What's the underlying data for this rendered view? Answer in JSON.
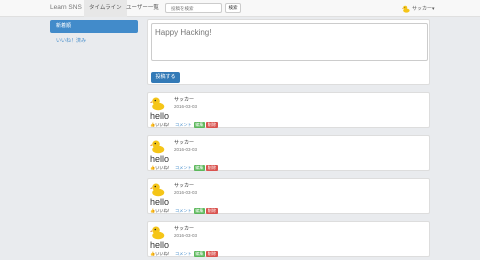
{
  "navbar": {
    "brand": "Learn SNS",
    "tabs": [
      {
        "label": "タイムライン"
      },
      {
        "label": "ユーザー一覧"
      }
    ],
    "search": {
      "placeholder": "投稿を検索",
      "button": "検索"
    },
    "user": {
      "name": "サッカー▾",
      "icon": "duck-icon"
    }
  },
  "sidebar": {
    "items": [
      {
        "label": "新着順"
      },
      {
        "label": "いいね！済み"
      }
    ]
  },
  "composer": {
    "placeholder": "Happy Hacking!",
    "submit": "投稿する"
  },
  "posts": [
    {
      "author": "サッカー",
      "date": "2016-03-03",
      "body": "hello",
      "like": "👍いいね！",
      "comment": "コメント",
      "edit": "編集",
      "delete": "削除"
    },
    {
      "author": "サッカー",
      "date": "2016-03-03",
      "body": "hello",
      "like": "👍いいね！",
      "comment": "コメント",
      "edit": "編集",
      "delete": "削除"
    },
    {
      "author": "サッカー",
      "date": "2016-03-03",
      "body": "hello",
      "like": "👍いいね！",
      "comment": "コメント",
      "edit": "編集",
      "delete": "削除"
    },
    {
      "author": "サッカー",
      "date": "2016-03-03",
      "body": "hello",
      "like": "👍いいね！",
      "comment": "コメント",
      "edit": "編集",
      "delete": "削除"
    }
  ],
  "colors": {
    "primary": "#337ab7",
    "success": "#5cb85c",
    "danger": "#d9534f",
    "background": "#e9ebee"
  }
}
